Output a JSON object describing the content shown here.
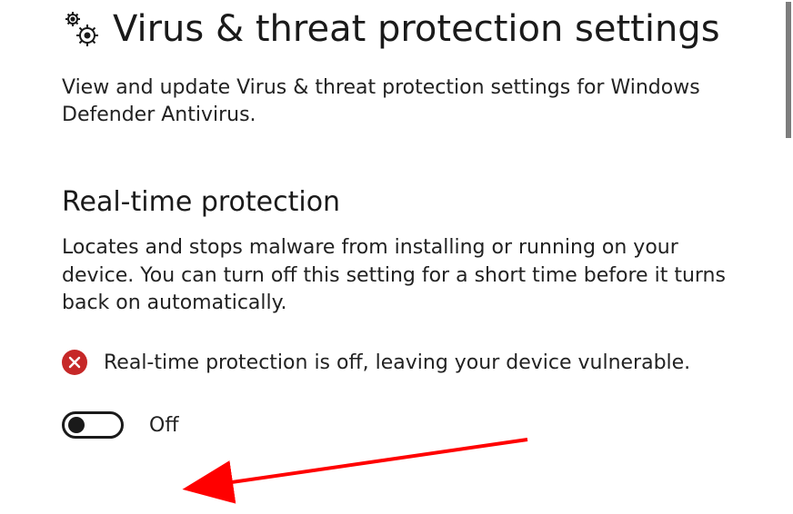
{
  "page": {
    "title": "Virus & threat protection settings",
    "description": "View and update Virus & threat protection settings for Windows Defender Antivirus."
  },
  "section": {
    "title": "Real-time protection",
    "description": "Locates and stops malware from installing or running on your device. You can turn off this setting for a short time before it turns back on automatically."
  },
  "alert": {
    "text": "Real-time protection is off, leaving your device vulnerable."
  },
  "toggle": {
    "state_label": "Off",
    "on": false
  },
  "colors": {
    "danger": "#C62828",
    "annotation": "#FF0000"
  }
}
